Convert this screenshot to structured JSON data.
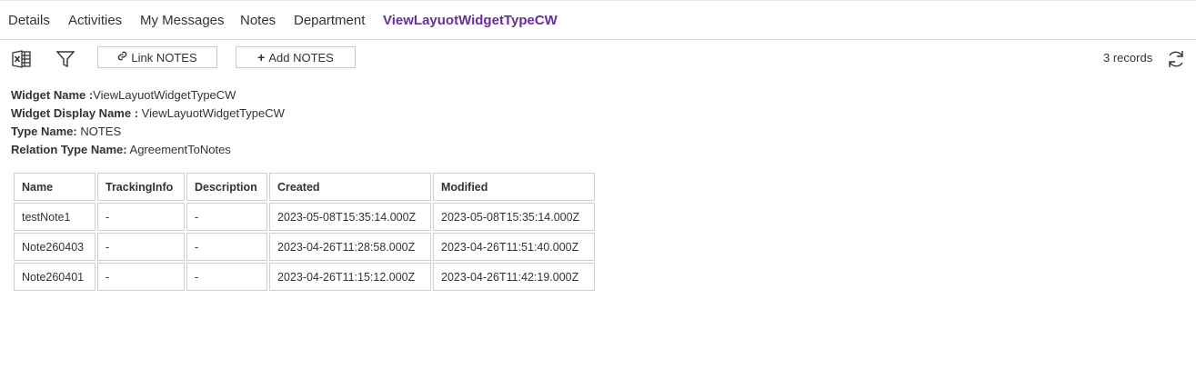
{
  "tabs": [
    {
      "label": "Details",
      "active": false
    },
    {
      "label": "Activities",
      "active": false
    },
    {
      "label": "My Messages",
      "active": false
    },
    {
      "label": "Notes",
      "active": false
    },
    {
      "label": "Department",
      "active": false
    },
    {
      "label": "ViewLayuotWidgetTypeCW",
      "active": true
    }
  ],
  "toolbar": {
    "excel_icon": "excel-icon",
    "filter_icon": "filter-icon",
    "link_button": "Link NOTES",
    "add_button": "Add NOTES",
    "records": "3 records",
    "refresh_icon": "refresh-icon"
  },
  "info": {
    "widget_name_label": "Widget Name :",
    "widget_name_value": "ViewLayuotWidgetTypeCW",
    "display_name_label": "Widget Display Name :",
    "display_name_value": " ViewLayuotWidgetTypeCW",
    "type_name_label": "Type Name:",
    "type_name_value": " NOTES",
    "relation_label": "Relation Type Name:",
    "relation_value": " AgreementToNotes"
  },
  "table": {
    "headers": [
      "Name",
      "TrackingInfo",
      "Description",
      "Created",
      "Modified"
    ],
    "rows": [
      [
        "testNote1",
        "-",
        "-",
        "2023-05-08T15:35:14.000Z",
        "2023-05-08T15:35:14.000Z"
      ],
      [
        "Note260403",
        "-",
        "-",
        "2023-04-26T11:28:58.000Z",
        "2023-04-26T11:51:40.000Z"
      ],
      [
        "Note260401",
        "-",
        "-",
        "2023-04-26T11:15:12.000Z",
        "2023-04-26T11:42:19.000Z"
      ]
    ]
  },
  "colors": {
    "accent": "#6a2c9e",
    "border": "#cfcfcf"
  }
}
